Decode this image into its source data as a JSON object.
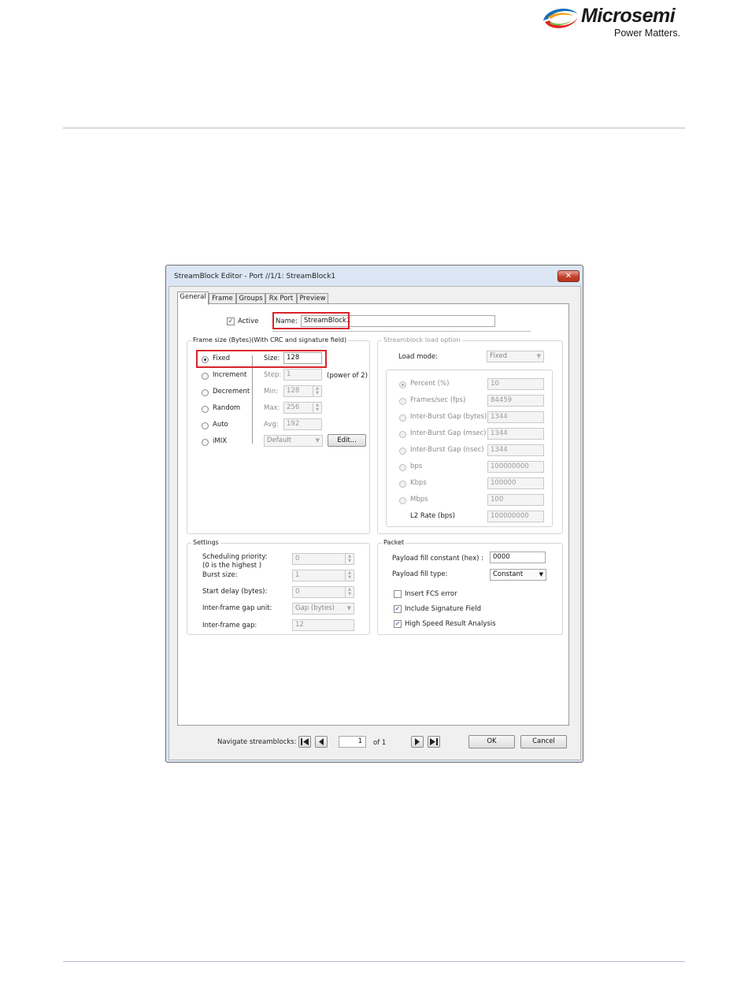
{
  "document": {
    "logo_text": "Microsemi",
    "logo_tagline": "Power Matters."
  },
  "window": {
    "title": "StreamBlock Editor - Port //1/1: StreamBlock1",
    "close_glyph": "✕"
  },
  "tabs": [
    {
      "label": "General"
    },
    {
      "label": "Frame"
    },
    {
      "label": "Groups"
    },
    {
      "label": "Rx Port"
    },
    {
      "label": "Preview"
    }
  ],
  "general": {
    "active_label": "Active",
    "active_checked": true,
    "name_label": "Name:",
    "name_value": "StreamBlock1"
  },
  "frame_size": {
    "legend": "Frame size (Bytes)(With CRC and signature field)",
    "options": [
      {
        "label": "Fixed",
        "selected": true
      },
      {
        "label": "Increment",
        "selected": false
      },
      {
        "label": "Decrement",
        "selected": false
      },
      {
        "label": "Random",
        "selected": false
      },
      {
        "label": "Auto",
        "selected": false
      },
      {
        "label": "iMIX",
        "selected": false
      }
    ],
    "size_label": "Size:",
    "size_value": "128",
    "step_label": "Step:",
    "step_value": "1",
    "step_note": "(power of 2)",
    "min_label": "Min:",
    "min_value": "128",
    "max_label": "Max:",
    "max_value": "256",
    "avg_label": "Avg:",
    "avg_value": "192",
    "imix_value": "Default",
    "edit_button": "Edit..."
  },
  "load_option": {
    "legend": "Streamblock load option",
    "load_mode_label": "Load mode:",
    "load_mode_value": "Fixed",
    "rows": [
      {
        "label": "Percent (%)",
        "value": "10",
        "control": "radio",
        "selected": true
      },
      {
        "label": "Frames/sec (fps)",
        "value": "84459",
        "control": "radio",
        "selected": false
      },
      {
        "label": "Inter-Burst Gap (bytes)",
        "value": "1344",
        "control": "radio",
        "selected": false
      },
      {
        "label": "Inter-Burst Gap (msec)",
        "value": "1344",
        "control": "radio",
        "selected": false
      },
      {
        "label": "Inter-Burst Gap (nsec)",
        "value": "1344",
        "control": "radio",
        "selected": false
      },
      {
        "label": "bps",
        "value": "100000000",
        "control": "radio",
        "selected": false
      },
      {
        "label": "Kbps",
        "value": "100000",
        "control": "radio",
        "selected": false
      },
      {
        "label": "Mbps",
        "value": "100",
        "control": "radio",
        "selected": false
      },
      {
        "label": "L2 Rate (bps)",
        "value": "100000000",
        "control": "none",
        "selected": false
      }
    ]
  },
  "settings": {
    "legend": "Settings",
    "scheduling_label": "Scheduling priority:",
    "scheduling_note": "(0 is the highest )",
    "scheduling_value": "0",
    "burst_label": "Burst size:",
    "burst_value": "1",
    "start_delay_label": "Start delay (bytes):",
    "start_delay_value": "0",
    "ifg_unit_label": "Inter-frame gap unit:",
    "ifg_unit_value": "Gap (bytes)",
    "ifg_label": "Inter-frame gap:",
    "ifg_value": "12"
  },
  "packet": {
    "legend": "Packet",
    "fill_constant_label": "Payload fill constant (hex) :",
    "fill_constant_value": "0000",
    "fill_type_label": "Payload fill type:",
    "fill_type_value": "Constant",
    "checks": [
      {
        "label": "Insert FCS error",
        "checked": false
      },
      {
        "label": "Include Signature Field",
        "checked": true
      },
      {
        "label": "High Speed Result Analysis",
        "checked": true
      }
    ]
  },
  "footer": {
    "navigate_label": "Navigate streamblocks:",
    "page_value": "1",
    "of_label": "of 1",
    "ok_label": "OK",
    "cancel_label": "Cancel"
  },
  "colors": {
    "highlight": "#d9232a",
    "window_frame": "#dbe6f4",
    "checkmark": "#1e3c8c"
  }
}
